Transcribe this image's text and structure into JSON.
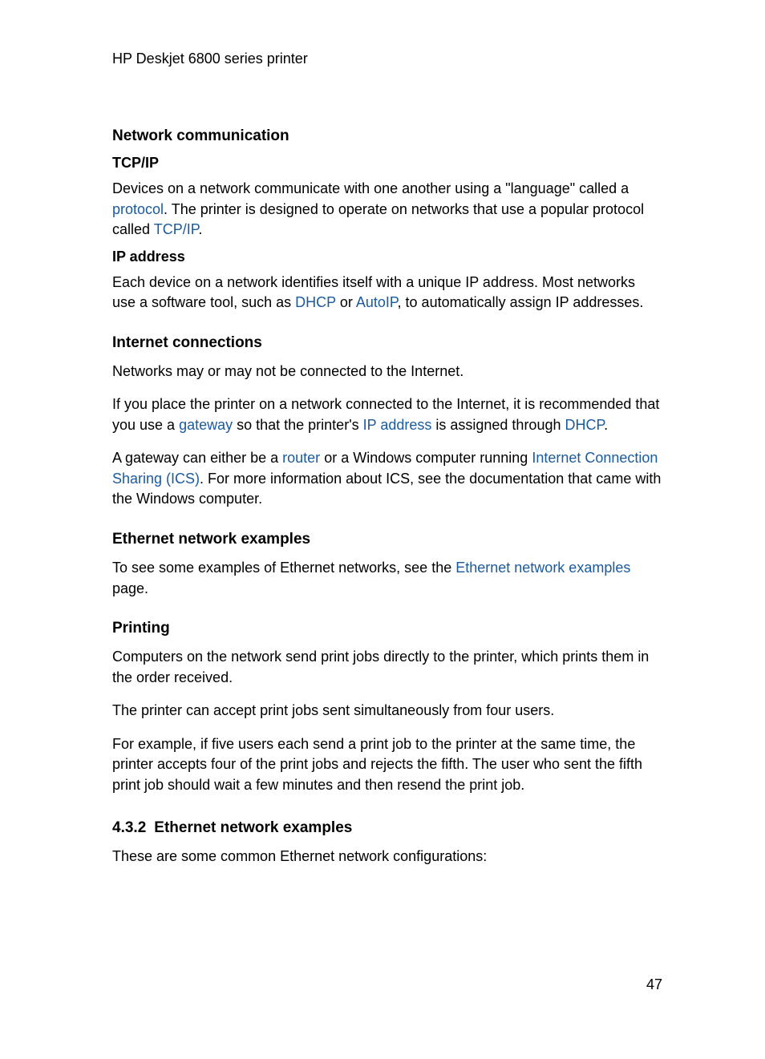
{
  "header": {
    "title": "HP Deskjet 6800 series printer"
  },
  "sections": {
    "netcomm": {
      "title": "Network communication",
      "tcpip": {
        "title": "TCP/IP",
        "p1a": "Devices on a network communicate with one another using a \"language\" called a ",
        "link_protocol": "protocol",
        "p1b": ". The printer is designed to operate on networks that use a popular protocol called ",
        "link_tcpip": "TCP/IP",
        "p1c": "."
      },
      "ipaddr": {
        "title": "IP address",
        "p1a": "Each device on a network identifies itself with a unique IP address. Most networks use a software tool, such as ",
        "link_dhcp": "DHCP",
        "p1b": " or ",
        "link_autoip": "AutoIP",
        "p1c": ", to automatically assign IP addresses."
      }
    },
    "internet": {
      "title": "Internet connections",
      "p1": "Networks may or may not be connected to the Internet.",
      "p2a": "If you place the printer on a network connected to the Internet, it is recommended that you use a ",
      "link_gateway": "gateway",
      "p2b": " so that the printer's ",
      "link_ipaddr": "IP address",
      "p2c": " is assigned through ",
      "link_dhcp": "DHCP",
      "p2d": ".",
      "p3a": "A gateway can either be a ",
      "link_router": "router",
      "p3b": " or a Windows computer running ",
      "link_ics": "Internet Connection Sharing (ICS)",
      "p3c": ". For more information about ICS, see the documentation that came with the Windows computer."
    },
    "ethernet_examples": {
      "title": "Ethernet network examples",
      "p1a": "To see some examples of Ethernet networks, see the ",
      "link_examples": "Ethernet network examples",
      "p1b": " page."
    },
    "printing": {
      "title": "Printing",
      "p1": "Computers on the network send print jobs directly to the printer, which prints them in the order received.",
      "p2": "The printer can accept print jobs sent simultaneously from four users.",
      "p3": "For example, if five users each send a print job to the printer at the same time, the printer accepts four of the print jobs and rejects the fifth. The user who sent the fifth print job should wait a few minutes and then resend the print job."
    },
    "section432": {
      "num": "4.3.2",
      "title": "Ethernet network examples",
      "p1": "These are some common Ethernet network configurations:"
    }
  },
  "page_number": "47"
}
